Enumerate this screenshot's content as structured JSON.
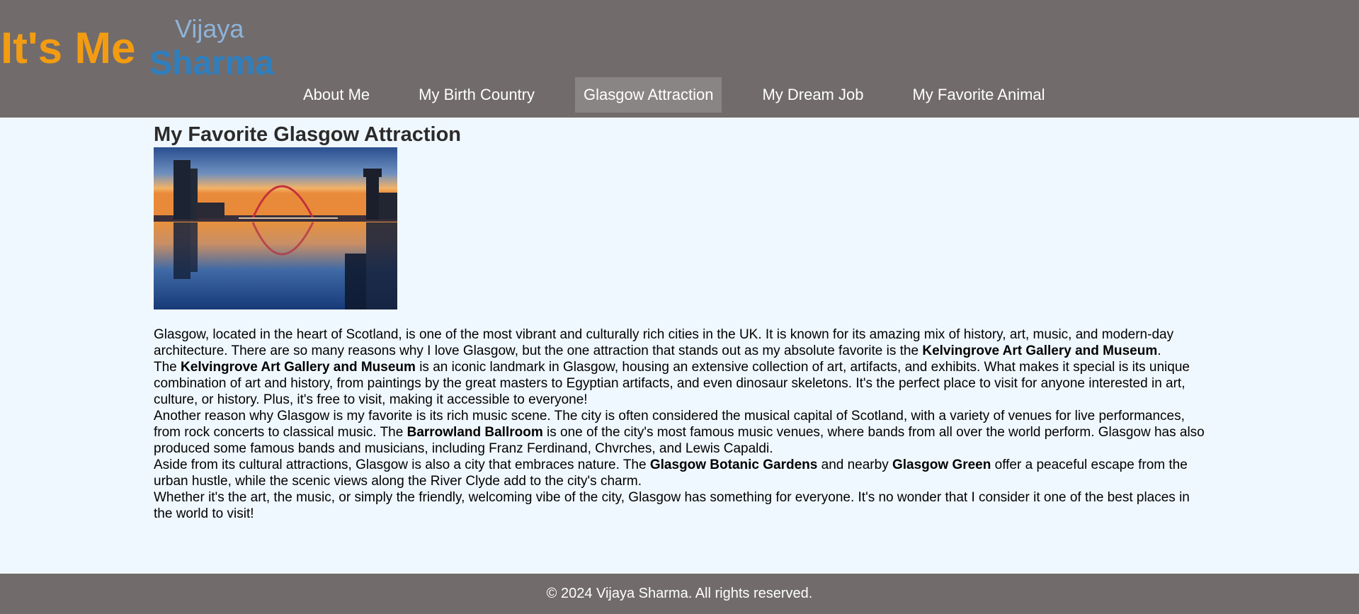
{
  "logo": {
    "tagline": "It's Me",
    "first_name": "Vijaya",
    "last_name": "Sharma"
  },
  "nav": {
    "items": [
      {
        "label": "About Me"
      },
      {
        "label": "My Birth Country"
      },
      {
        "label": "Glasgow Attraction"
      },
      {
        "label": "My Dream Job"
      },
      {
        "label": "My Favorite Animal"
      }
    ],
    "active": "Glasgow Attraction"
  },
  "main": {
    "title": "My Favorite Glasgow Attraction",
    "image_subject": "clyde-arc-bridge-at-sunset",
    "paragraphs": [
      [
        {
          "t": "Glasgow, located in the heart of Scotland, is one of the most vibrant and culturally rich cities in the UK. It is known for its amazing mix of history, art, music, and modern-day architecture. There are so many reasons why I love Glasgow, but the one attraction that stands out as my absolute favorite is the "
        },
        {
          "t": "Kelvingrove Art Gallery and Museum",
          "b": true
        },
        {
          "t": "."
        }
      ],
      [
        {
          "t": "The "
        },
        {
          "t": "Kelvingrove Art Gallery and Museum",
          "b": true
        },
        {
          "t": " is an iconic landmark in Glasgow, housing an extensive collection of art, artifacts, and exhibits. What makes it special is its unique combination of art and history, from paintings by the great masters to Egyptian artifacts, and even dinosaur skeletons. It's the perfect place to visit for anyone interested in art, culture, or history. Plus, it's free to visit, making it accessible to everyone!"
        }
      ],
      [
        {
          "t": "Another reason why Glasgow is my favorite is its rich music scene. The city is often considered the musical capital of Scotland, with a variety of venues for live performances, from rock concerts to classical music. The "
        },
        {
          "t": "Barrowland Ballroom",
          "b": true
        },
        {
          "t": " is one of the city's most famous music venues, where bands from all over the world perform. Glasgow has also produced some famous bands and musicians, including Franz Ferdinand, Chvrches, and Lewis Capaldi."
        }
      ],
      [
        {
          "t": "Aside from its cultural attractions, Glasgow is also a city that embraces nature. The "
        },
        {
          "t": "Glasgow Botanic Gardens",
          "b": true
        },
        {
          "t": " and nearby "
        },
        {
          "t": "Glasgow Green",
          "b": true
        },
        {
          "t": " offer a peaceful escape from the urban hustle, while the scenic views along the River Clyde add to the city's charm."
        }
      ],
      [
        {
          "t": "Whether it's the art, the music, or simply the friendly, welcoming vibe of the city, Glasgow has something for everyone. It's no wonder that I consider it one of the best places in the world to visit!"
        }
      ]
    ]
  },
  "footer": {
    "text": "© 2024 Vijaya Sharma. All rights reserved."
  },
  "colors": {
    "header_bg": "#716b6b",
    "page_bg": "#f0f8ff",
    "logo_orange": "#f39c12",
    "logo_blue": "#2f7fbf",
    "logo_light_blue": "#8fb3d9",
    "nav_active_bg": "#8a8585"
  }
}
